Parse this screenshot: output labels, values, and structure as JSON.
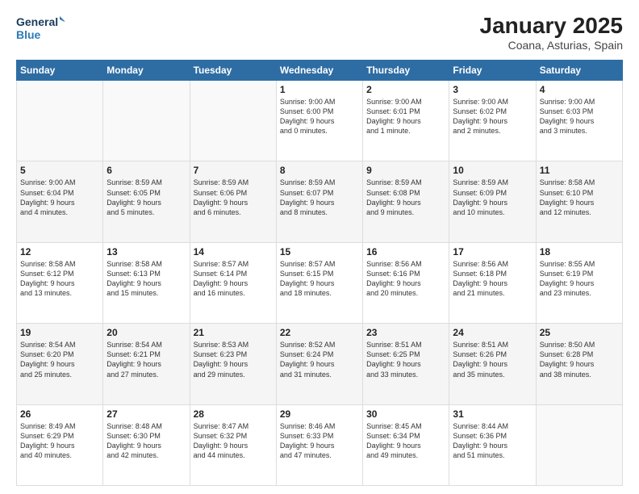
{
  "logo": {
    "line1": "General",
    "line2": "Blue"
  },
  "title": "January 2025",
  "subtitle": "Coana, Asturias, Spain",
  "days_of_week": [
    "Sunday",
    "Monday",
    "Tuesday",
    "Wednesday",
    "Thursday",
    "Friday",
    "Saturday"
  ],
  "weeks": [
    [
      {
        "day": "",
        "data": ""
      },
      {
        "day": "",
        "data": ""
      },
      {
        "day": "",
        "data": ""
      },
      {
        "day": "1",
        "data": "Sunrise: 9:00 AM\nSunset: 6:00 PM\nDaylight: 9 hours\nand 0 minutes."
      },
      {
        "day": "2",
        "data": "Sunrise: 9:00 AM\nSunset: 6:01 PM\nDaylight: 9 hours\nand 1 minute."
      },
      {
        "day": "3",
        "data": "Sunrise: 9:00 AM\nSunset: 6:02 PM\nDaylight: 9 hours\nand 2 minutes."
      },
      {
        "day": "4",
        "data": "Sunrise: 9:00 AM\nSunset: 6:03 PM\nDaylight: 9 hours\nand 3 minutes."
      }
    ],
    [
      {
        "day": "5",
        "data": "Sunrise: 9:00 AM\nSunset: 6:04 PM\nDaylight: 9 hours\nand 4 minutes."
      },
      {
        "day": "6",
        "data": "Sunrise: 8:59 AM\nSunset: 6:05 PM\nDaylight: 9 hours\nand 5 minutes."
      },
      {
        "day": "7",
        "data": "Sunrise: 8:59 AM\nSunset: 6:06 PM\nDaylight: 9 hours\nand 6 minutes."
      },
      {
        "day": "8",
        "data": "Sunrise: 8:59 AM\nSunset: 6:07 PM\nDaylight: 9 hours\nand 8 minutes."
      },
      {
        "day": "9",
        "data": "Sunrise: 8:59 AM\nSunset: 6:08 PM\nDaylight: 9 hours\nand 9 minutes."
      },
      {
        "day": "10",
        "data": "Sunrise: 8:59 AM\nSunset: 6:09 PM\nDaylight: 9 hours\nand 10 minutes."
      },
      {
        "day": "11",
        "data": "Sunrise: 8:58 AM\nSunset: 6:10 PM\nDaylight: 9 hours\nand 12 minutes."
      }
    ],
    [
      {
        "day": "12",
        "data": "Sunrise: 8:58 AM\nSunset: 6:12 PM\nDaylight: 9 hours\nand 13 minutes."
      },
      {
        "day": "13",
        "data": "Sunrise: 8:58 AM\nSunset: 6:13 PM\nDaylight: 9 hours\nand 15 minutes."
      },
      {
        "day": "14",
        "data": "Sunrise: 8:57 AM\nSunset: 6:14 PM\nDaylight: 9 hours\nand 16 minutes."
      },
      {
        "day": "15",
        "data": "Sunrise: 8:57 AM\nSunset: 6:15 PM\nDaylight: 9 hours\nand 18 minutes."
      },
      {
        "day": "16",
        "data": "Sunrise: 8:56 AM\nSunset: 6:16 PM\nDaylight: 9 hours\nand 20 minutes."
      },
      {
        "day": "17",
        "data": "Sunrise: 8:56 AM\nSunset: 6:18 PM\nDaylight: 9 hours\nand 21 minutes."
      },
      {
        "day": "18",
        "data": "Sunrise: 8:55 AM\nSunset: 6:19 PM\nDaylight: 9 hours\nand 23 minutes."
      }
    ],
    [
      {
        "day": "19",
        "data": "Sunrise: 8:54 AM\nSunset: 6:20 PM\nDaylight: 9 hours\nand 25 minutes."
      },
      {
        "day": "20",
        "data": "Sunrise: 8:54 AM\nSunset: 6:21 PM\nDaylight: 9 hours\nand 27 minutes."
      },
      {
        "day": "21",
        "data": "Sunrise: 8:53 AM\nSunset: 6:23 PM\nDaylight: 9 hours\nand 29 minutes."
      },
      {
        "day": "22",
        "data": "Sunrise: 8:52 AM\nSunset: 6:24 PM\nDaylight: 9 hours\nand 31 minutes."
      },
      {
        "day": "23",
        "data": "Sunrise: 8:51 AM\nSunset: 6:25 PM\nDaylight: 9 hours\nand 33 minutes."
      },
      {
        "day": "24",
        "data": "Sunrise: 8:51 AM\nSunset: 6:26 PM\nDaylight: 9 hours\nand 35 minutes."
      },
      {
        "day": "25",
        "data": "Sunrise: 8:50 AM\nSunset: 6:28 PM\nDaylight: 9 hours\nand 38 minutes."
      }
    ],
    [
      {
        "day": "26",
        "data": "Sunrise: 8:49 AM\nSunset: 6:29 PM\nDaylight: 9 hours\nand 40 minutes."
      },
      {
        "day": "27",
        "data": "Sunrise: 8:48 AM\nSunset: 6:30 PM\nDaylight: 9 hours\nand 42 minutes."
      },
      {
        "day": "28",
        "data": "Sunrise: 8:47 AM\nSunset: 6:32 PM\nDaylight: 9 hours\nand 44 minutes."
      },
      {
        "day": "29",
        "data": "Sunrise: 8:46 AM\nSunset: 6:33 PM\nDaylight: 9 hours\nand 47 minutes."
      },
      {
        "day": "30",
        "data": "Sunrise: 8:45 AM\nSunset: 6:34 PM\nDaylight: 9 hours\nand 49 minutes."
      },
      {
        "day": "31",
        "data": "Sunrise: 8:44 AM\nSunset: 6:36 PM\nDaylight: 9 hours\nand 51 minutes."
      },
      {
        "day": "",
        "data": ""
      }
    ]
  ]
}
